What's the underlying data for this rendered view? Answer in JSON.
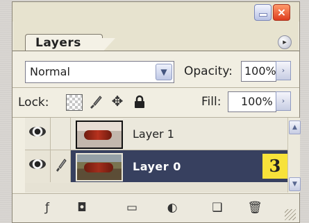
{
  "panel": {
    "tab_label": "Layers",
    "menu_icon": "panel-menu-arrow-icon"
  },
  "window_controls": {
    "minimize_icon": "minimize-icon",
    "close_label": "×"
  },
  "blend_mode": {
    "value": "Normal",
    "dropdown_icon": "chevron-down-icon"
  },
  "opacity": {
    "label": "Opacity:",
    "value": "100%",
    "arrow": "›"
  },
  "lock": {
    "label": "Lock:",
    "icons": [
      "lock-transparency-icon",
      "lock-brush-icon",
      "lock-move-icon",
      "lock-all-icon"
    ],
    "move_glyph": "✥"
  },
  "fill": {
    "label": "Fill:",
    "value": "100%",
    "arrow": "›"
  },
  "layers": [
    {
      "name": "Layer 1",
      "selected": false,
      "visible": true
    },
    {
      "name": "Layer 0",
      "selected": true,
      "visible": true
    }
  ],
  "annotation": {
    "step": "3"
  },
  "scroll": {
    "up": "▲",
    "down": "▼"
  },
  "bottom_toolbar": {
    "style_glyph": "ƒ",
    "mask_glyph": "◘",
    "folder_glyph": "▭",
    "adjust_glyph": "◐",
    "new_glyph": "❑",
    "trash_glyph": "🗑"
  },
  "colors": {
    "selected_row": "#37405f",
    "badge": "#f7e23a",
    "close_button": "#dd3c1e"
  }
}
